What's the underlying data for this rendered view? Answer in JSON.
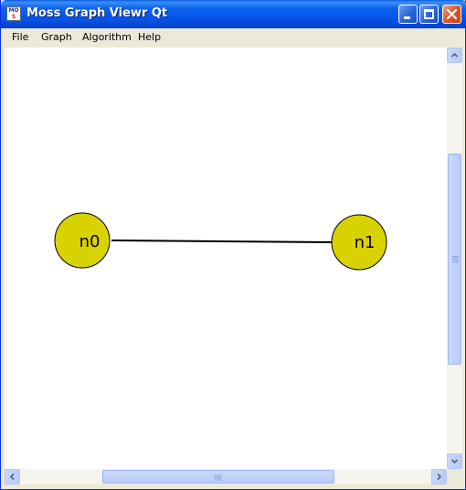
{
  "window": {
    "title": "Moss Graph Viewr Qt",
    "app_icon_text_top": "MO",
    "app_icon_text_bottom": "S",
    "titlebar_color": "#0a5ee0",
    "close_button_color": "#e0542c"
  },
  "menubar": {
    "items": [
      "File",
      "Graph",
      "Algorithm",
      "Help"
    ]
  },
  "graph": {
    "node_fill": "#d8d200",
    "node_stroke": "#000000",
    "edge_color": "#000000",
    "nodes": [
      {
        "id": "n0",
        "label": "n0"
      },
      {
        "id": "n1",
        "label": "n1"
      }
    ],
    "edges": [
      {
        "from": "n0",
        "to": "n1"
      }
    ]
  },
  "scrollbars": {
    "vertical": {
      "up_icon": "arrow-up-icon",
      "down_icon": "arrow-down-icon"
    },
    "horizontal": {
      "left_icon": "arrow-left-icon",
      "right_icon": "arrow-right-icon"
    }
  }
}
